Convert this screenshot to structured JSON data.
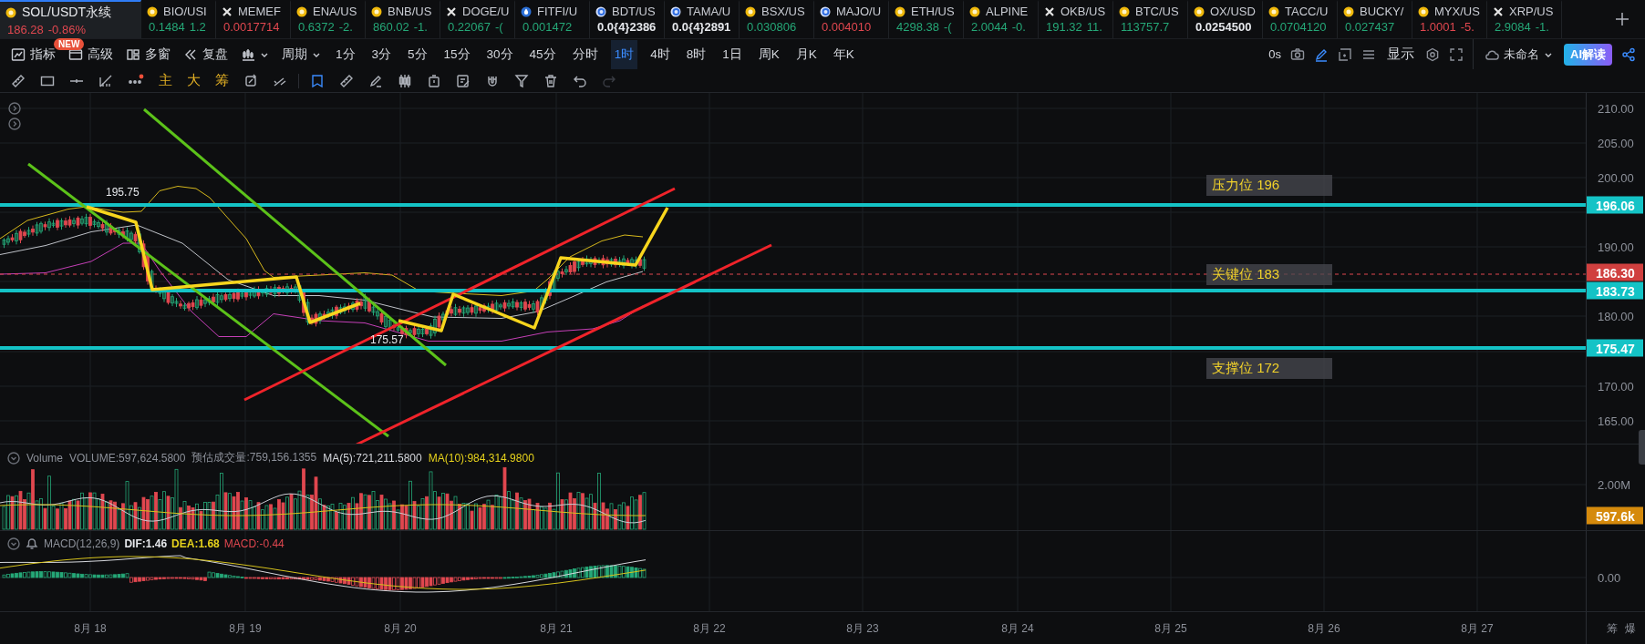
{
  "ticker_tabs": [
    {
      "symbol": "SOL/USDT永续",
      "price": "186.28",
      "change": "-0.86%",
      "kind": "down",
      "selected": true
    },
    {
      "symbol": "BIO/USI",
      "price": "0.1484",
      "change": "1.2",
      "kind": "up",
      "selected": false
    },
    {
      "symbol": "MEMEF",
      "price": "0.0017714",
      "kind": "down",
      "selected": false
    },
    {
      "symbol": "ENA/US",
      "price": "0.6372",
      "change": "-2.",
      "kind": "up",
      "selected": false
    },
    {
      "symbol": "BNB/US",
      "price": "860.02",
      "change": "-1.",
      "kind": "up",
      "selected": false
    },
    {
      "symbol": "DOGE/U",
      "price": "0.22067",
      "change": "-(",
      "kind": "up",
      "selected": false
    },
    {
      "symbol": "FITFI/U",
      "price": "0.001472",
      "kind": "up",
      "selected": false
    },
    {
      "symbol": "BDT/US",
      "price": "0.0{4}2386",
      "kind": "flat",
      "selected": false
    },
    {
      "symbol": "TAMA/U",
      "price": "0.0{4}2891",
      "kind": "flat",
      "selected": false
    },
    {
      "symbol": "BSX/US",
      "price": "0.030806",
      "kind": "up",
      "selected": false
    },
    {
      "symbol": "MAJO/U",
      "price": "0.004010",
      "kind": "down",
      "selected": false
    },
    {
      "symbol": "ETH/US",
      "price": "4298.38",
      "change": "-(",
      "kind": "up",
      "selected": false
    },
    {
      "symbol": "ALPINE",
      "price": "2.0044",
      "change": "-0.",
      "kind": "up",
      "selected": false
    },
    {
      "symbol": "OKB/US",
      "price": "191.32",
      "change": "11.",
      "kind": "up",
      "selected": false
    },
    {
      "symbol": "BTC/US",
      "price": "113757.7",
      "kind": "up",
      "selected": false
    },
    {
      "symbol": "OX/USD",
      "price": "0.0254500",
      "kind": "flat",
      "selected": false
    },
    {
      "symbol": "TACC/U",
      "price": "0.0704120",
      "kind": "up",
      "selected": false
    },
    {
      "symbol": "BUCKY/",
      "price": "0.027437",
      "kind": "up",
      "selected": false
    },
    {
      "symbol": "MYX/US",
      "price": "1.0001",
      "change": "-5.",
      "kind": "down",
      "selected": false
    },
    {
      "symbol": "XRP/US",
      "price": "2.9084",
      "change": "-1.",
      "kind": "up",
      "selected": false
    }
  ],
  "main_toolbar": {
    "tools": [
      {
        "label": "指标"
      },
      {
        "label": "高级",
        "badge": "NEW"
      },
      {
        "label": "多窗"
      },
      {
        "label": "复盘"
      }
    ],
    "period_menu": "周期",
    "periods": [
      {
        "label": "1分",
        "selected": false
      },
      {
        "label": "3分",
        "selected": false
      },
      {
        "label": "5分",
        "selected": false
      },
      {
        "label": "15分",
        "selected": false
      },
      {
        "label": "30分",
        "selected": false
      },
      {
        "label": "45分",
        "selected": false
      },
      {
        "label": "分时",
        "selected": false
      },
      {
        "label": "1时",
        "selected": true
      },
      {
        "label": "4时",
        "selected": false
      },
      {
        "label": "8时",
        "selected": false
      },
      {
        "label": "1日",
        "selected": false
      },
      {
        "label": "周K",
        "selected": false
      },
      {
        "label": "月K",
        "selected": false
      },
      {
        "label": "年K",
        "selected": false
      }
    ],
    "timer": "0s",
    "display": "显示",
    "layout_name": "未命名",
    "ai_button": "AI解读"
  },
  "drawing_toolbar": {
    "shortcuts": [
      "主",
      "大",
      "筹"
    ],
    "undo_disabled": false,
    "redo_disabled": true
  },
  "chart": {
    "high_label": "195.75",
    "low_label": "175.57",
    "levels": [
      {
        "label": "压力位 196",
        "tag": "196.06"
      },
      {
        "label": "关键位 183",
        "tag": "183.73"
      },
      {
        "label": "支撑位 172",
        "tag": "175.47"
      }
    ],
    "last_price_tag": "186.30",
    "price_axis": [
      "210.00",
      "205.00",
      "200.00",
      "190.00",
      "180.00",
      "170.00",
      "165.00"
    ]
  },
  "volume": {
    "title": "Volume",
    "volume": "VOLUME:597,624.5800",
    "estimate": "预估成交量:759,156.1355",
    "ma5": "MA(5):721,211.5800",
    "ma10": "MA(10):984,314.9800",
    "axis": [
      "2.00M"
    ],
    "last_tag": "597.6k"
  },
  "macd": {
    "title": "MACD(12,26,9)",
    "dif": "DIF:1.46",
    "dea": "DEA:1.68",
    "macd": "MACD:-0.44",
    "axis": [
      "0.00"
    ]
  },
  "date_axis": [
    "8月 18",
    "8月 19",
    "8月 20",
    "8月 21",
    "8月 22",
    "8月 23",
    "8月 24",
    "8月 25",
    "8月 26",
    "8月 27"
  ],
  "side_labels": [
    "筹",
    "爆"
  ]
}
